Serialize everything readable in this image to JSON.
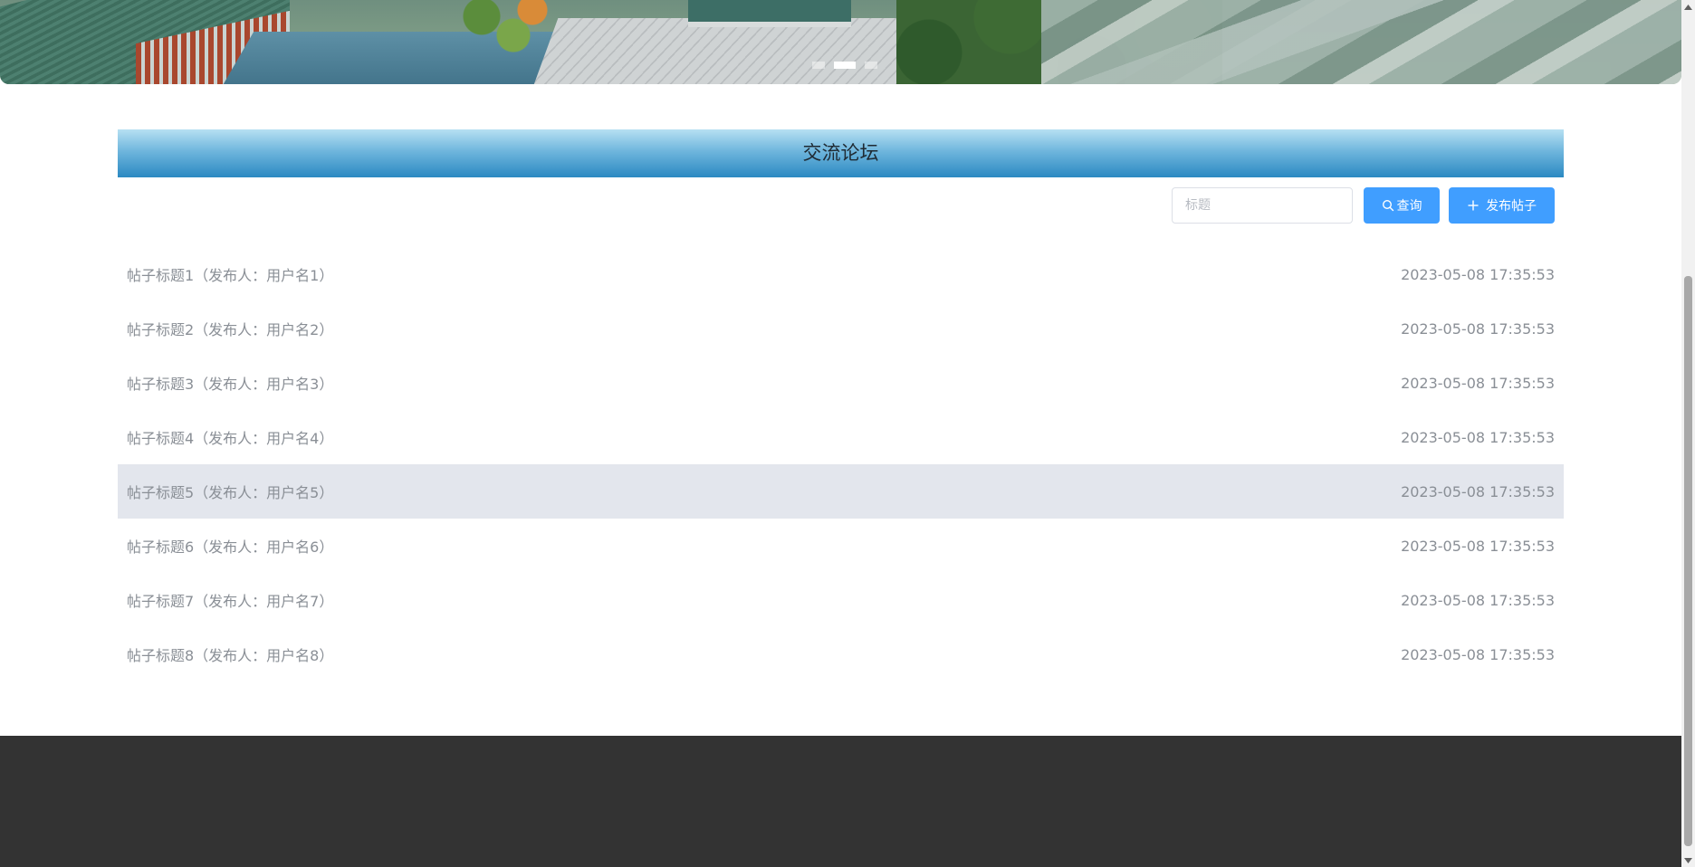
{
  "forum": {
    "title": "交流论坛",
    "search_placeholder": "标题",
    "search_button": "查询",
    "publish_button": "发布帖子",
    "posts": [
      {
        "title": "帖子标题1（发布人：用户名1）",
        "time": "2023-05-08 17:35:53"
      },
      {
        "title": "帖子标题2（发布人：用户名2）",
        "time": "2023-05-08 17:35:53"
      },
      {
        "title": "帖子标题3（发布人：用户名3）",
        "time": "2023-05-08 17:35:53"
      },
      {
        "title": "帖子标题4（发布人：用户名4）",
        "time": "2023-05-08 17:35:53"
      },
      {
        "title": "帖子标题5（发布人：用户名5）",
        "time": "2023-05-08 17:35:53"
      },
      {
        "title": "帖子标题6（发布人：用户名6）",
        "time": "2023-05-08 17:35:53"
      },
      {
        "title": "帖子标题7（发布人：用户名7）",
        "time": "2023-05-08 17:35:53"
      },
      {
        "title": "帖子标题8（发布人：用户名8）",
        "time": "2023-05-08 17:35:53"
      }
    ]
  },
  "carousel": {
    "slide_count": 3,
    "active_index": 1
  },
  "icons": {
    "search": "search-icon",
    "publish": "plus-icon"
  },
  "colors": {
    "accent": "#409eff",
    "header_gradient_top": "#b6e0f2",
    "header_gradient_bottom": "#2b89c2",
    "row_hover": "#e3e6ed",
    "footer": "#333333"
  }
}
